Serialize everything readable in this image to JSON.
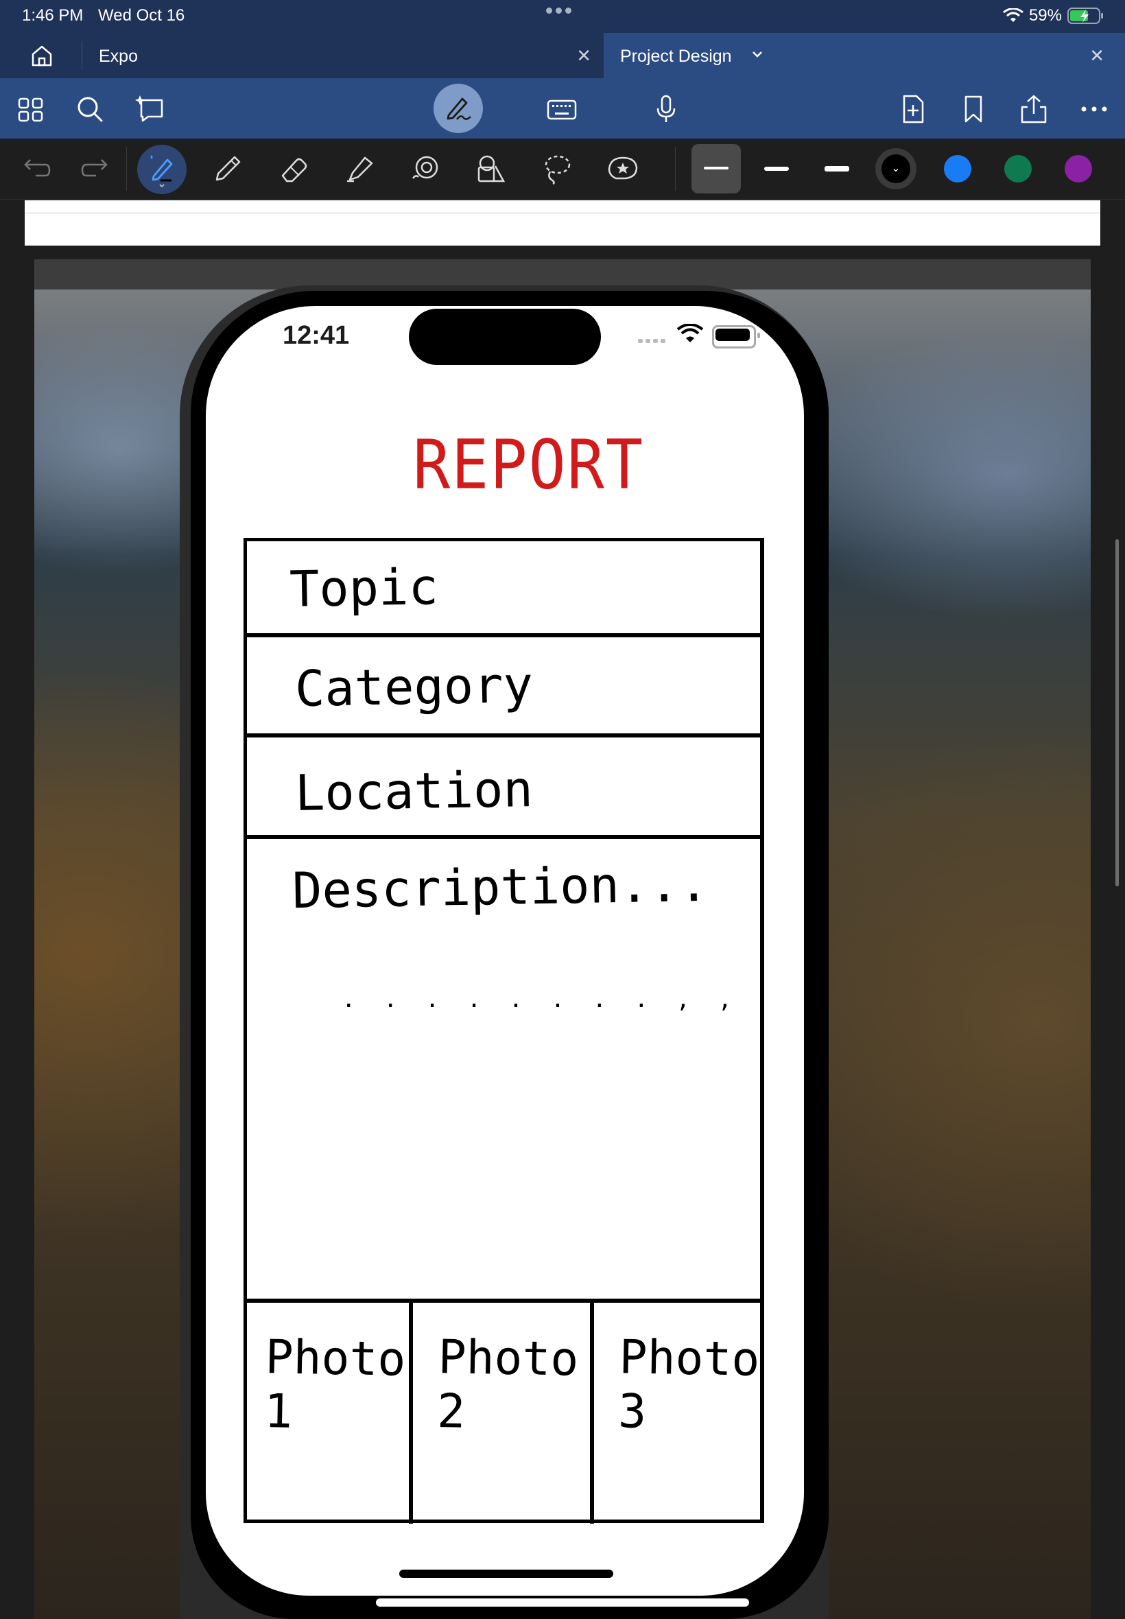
{
  "status_bar": {
    "time": "1:46 PM",
    "date": "Wed Oct 16",
    "battery": "59%"
  },
  "tabs": [
    {
      "label": "Expo",
      "active": false
    },
    {
      "label": "Project Design",
      "active": true
    }
  ],
  "toolbar": {
    "left_icons": [
      "grid-icon",
      "search-icon",
      "sparkle-chat-icon"
    ],
    "center_icons": [
      "pen-mode-icon",
      "keyboard-icon",
      "microphone-icon"
    ],
    "right_icons": [
      "add-page-icon",
      "bookmark-icon",
      "share-icon",
      "more-icon"
    ]
  },
  "pen_tools": {
    "tools": [
      "undo-icon",
      "redo-icon",
      "fountain-pen-icon",
      "pencil-icon",
      "eraser-icon",
      "highlighter-icon",
      "shape-icon",
      "element-icon",
      "lasso-icon",
      "sticker-icon"
    ],
    "selected_tool": "fountain-pen-icon",
    "colors": [
      "#000000",
      "#1a7cf5",
      "#0f7a4f",
      "#8b22a6"
    ],
    "selected_color": "#000000"
  },
  "phone": {
    "time": "12:41",
    "title": "REPORT",
    "title_color": "#d11a1a",
    "fields": [
      "Topic",
      "Category",
      "Location",
      "Description..."
    ],
    "description_dots": ". . . . .  .  .  .  ,  ,",
    "photos": [
      "Photo 1",
      "Photo 2",
      "Photo 3"
    ]
  }
}
